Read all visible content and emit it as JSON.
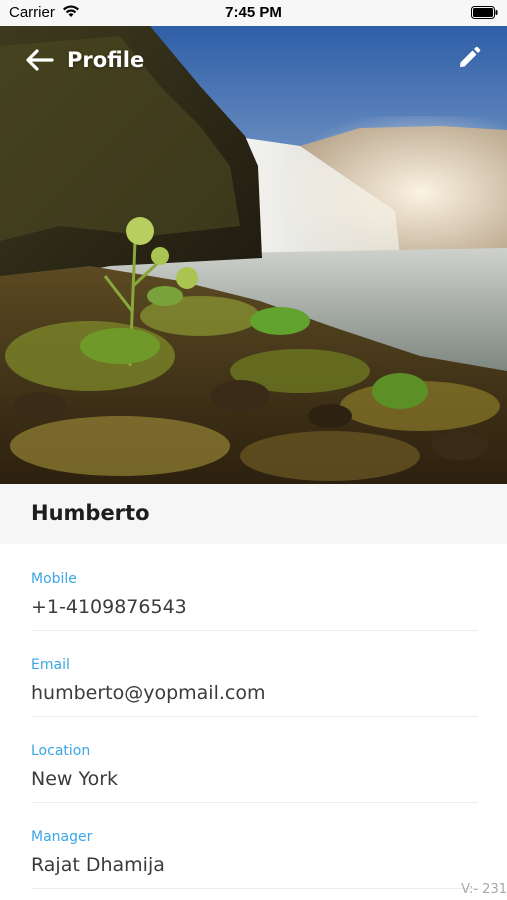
{
  "status_bar": {
    "carrier": "Carrier",
    "time": "7:45 PM"
  },
  "header": {
    "title": "Profile",
    "back_icon": "arrow-left-icon",
    "edit_icon": "pencil-icon"
  },
  "profile": {
    "name": "Humberto",
    "fields": [
      {
        "label": "Mobile",
        "value": "+1-4109876543"
      },
      {
        "label": "Email",
        "value": "humberto@yopmail.com"
      },
      {
        "label": "Location",
        "value": "New York"
      },
      {
        "label": "Manager",
        "value": "Rajat Dhamija"
      }
    ]
  },
  "version": "V:- 231",
  "colors": {
    "label": "#3aa6e4",
    "value": "#3b3b3b",
    "name_bar": "#f6f6f6"
  }
}
